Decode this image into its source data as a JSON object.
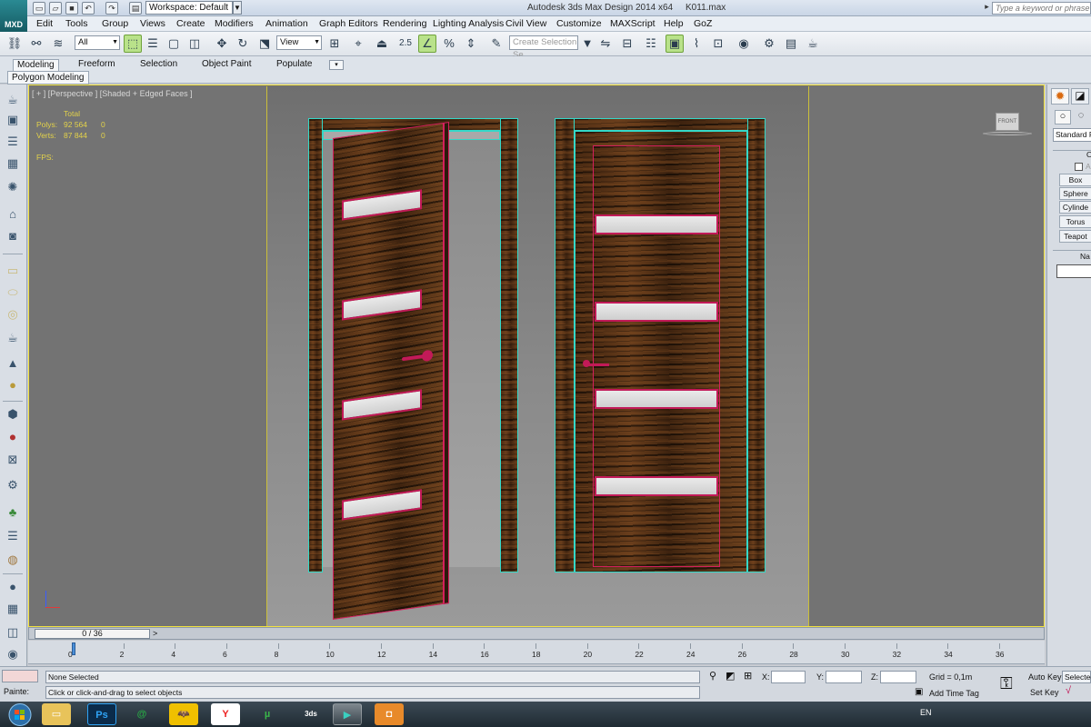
{
  "title_bar": {
    "app_logo_text": "MXD",
    "workspace_label": "Workspace: Default",
    "app_title": "Autodesk 3ds Max Design 2014 x64",
    "file_name": "K011.max",
    "search_placeholder": "Type a keyword or phrase"
  },
  "menu": {
    "items": [
      "Edit",
      "Tools",
      "Group",
      "Views",
      "Create",
      "Modifiers",
      "Animation",
      "Graph Editors",
      "Rendering",
      "Lighting Analysis",
      "Civil View",
      "Customize",
      "MAXScript",
      "Help",
      "GoZ"
    ]
  },
  "toolbar": {
    "selection_filter": "All",
    "reference_coord": "View",
    "snap_value": "2.5",
    "named_selection_placeholder": "Create Selection Se"
  },
  "ribbon": {
    "tabs": [
      "Modeling",
      "Freeform",
      "Selection",
      "Object Paint",
      "Populate"
    ],
    "active_tab": "Modeling",
    "sub_panel": "Polygon Modeling"
  },
  "viewport": {
    "label": "[ + ] [Perspective ] [Shaded + Edged Faces ]",
    "stats_header": "Total",
    "polys_label": "Polys:",
    "polys_total": "92 564",
    "polys_sel": "0",
    "verts_label": "Verts:",
    "verts_total": "87 844",
    "verts_sel": "0",
    "fps_label": "FPS:",
    "view_cube_label": "FRONT",
    "accent_color": "#f3e33f"
  },
  "time_slider": {
    "position": "0 / 36",
    "next_label": ">"
  },
  "trackbar": {
    "ticks": [
      "0",
      "2",
      "4",
      "6",
      "8",
      "10",
      "12",
      "14",
      "16",
      "18",
      "20",
      "22",
      "24",
      "26",
      "28",
      "30",
      "32",
      "34",
      "36"
    ]
  },
  "command_panel": {
    "dropdown": "Standard P",
    "section_label": "O",
    "autogrid_label": "A",
    "buttons": [
      "Box",
      "Sphere",
      "Cylinde",
      "Torus",
      "Teapot"
    ],
    "name_label": "Na"
  },
  "status": {
    "selection": "None Selected",
    "prompt": "Click or click-and-drag to select objects",
    "maxscript_label": "Painte:",
    "x_label": "X:",
    "y_label": "Y:",
    "z_label": "Z:",
    "grid": "Grid = 0,1m",
    "add_time_tag": "Add Time Tag",
    "auto_key": "Auto Key",
    "selected": "Selected",
    "set_key": "Set Key"
  },
  "taskbar": {
    "apps": [
      "Ps",
      "@",
      "",
      "Y",
      "µ",
      "3ds",
      "",
      ""
    ],
    "language": "EN"
  }
}
